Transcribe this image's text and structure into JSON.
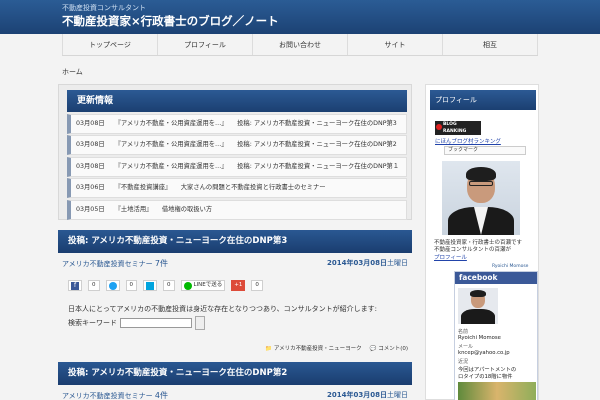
{
  "header": {
    "tagline": "不動産投資コンサルタント",
    "title": "不動産投資家×行政書士のブログ／ノート"
  },
  "nav": [
    "トップページ",
    "プロフィール",
    "お問い合わせ",
    "サイト",
    "相互"
  ],
  "breadcrumb": "ホーム",
  "updates": {
    "title": "更新情報",
    "items": [
      {
        "date": "03月08日",
        "text": "『アメリカ不動産・公用資産運用を…』　　投稿: アメリカ不動産投資・ニューヨーク在住のDNP第3"
      },
      {
        "date": "03月08日",
        "text": "『アメリカ不動産・公用資産運用を…』　　投稿: アメリカ不動産投資・ニューヨーク在住のDNP第2"
      },
      {
        "date": "03月08日",
        "text": "『アメリカ不動産・公用資産運用を…』　　投稿: アメリカ不動産投資・ニューヨーク在住のDNP第１"
      },
      {
        "date": "03月06日",
        "text": "『不動産投資講座』　　大家さんの問題と不動産投資と行政書士のセミナー"
      },
      {
        "date": "03月05日",
        "text": "『土地活用』　　借地権の取扱い方"
      }
    ]
  },
  "posts": [
    {
      "title": "投稿: アメリカ不動産投資・ニューヨーク在住のDNP第3",
      "meta_label": "アメリカ不動産投資セミナー",
      "count": "7件",
      "date": "2014年03月08日",
      "date_suffix": "土曜日"
    },
    {
      "title": "投稿: アメリカ不動産投資・ニューヨーク在住のDNP第2",
      "meta_label": "アメリカ不動産投資セミナー",
      "count": "4件",
      "date": "2014年03月08日",
      "date_suffix": "土曜日"
    }
  ],
  "share": {
    "facebook": "f",
    "facebook_count": "0",
    "twitter_count": "0",
    "bookmark_count": "0",
    "line_label": "LINEで送る",
    "gplus_label": "+1",
    "gplus_count": "0"
  },
  "post_body": "日本人にとってアメリカの不動産投資は身近な存在となりつつあり、コンサルタントが紹介します:",
  "search_label": "検索キーワード",
  "post_footer": {
    "category": "アメリカ不動産投資・ニューヨーク",
    "comments": "コメント(0)"
  },
  "sidebar": {
    "title": "プロフィール",
    "ranking_line1": "BLOG",
    "ranking_line2": "RANKING",
    "ranking_link": "にほんブログ村ランキング",
    "bookmark": "ブックマーク",
    "caption_line1": "不動産投資家・行政書士の百瀬です",
    "caption_line2": "不動産コンサルタントの百瀬が",
    "caption_link": "プロフィール",
    "name_en": "Ryoichi Momose",
    "fb": {
      "brand": "facebook",
      "name_label": "名前",
      "name": "Ryoichi Momose",
      "mail_label": "メール",
      "mail": "kncep@yahoo.co.jp",
      "recent_label": "近況",
      "recent1": "今回はアパートメントの",
      "recent2": "ロタイプの18階に物件"
    }
  }
}
